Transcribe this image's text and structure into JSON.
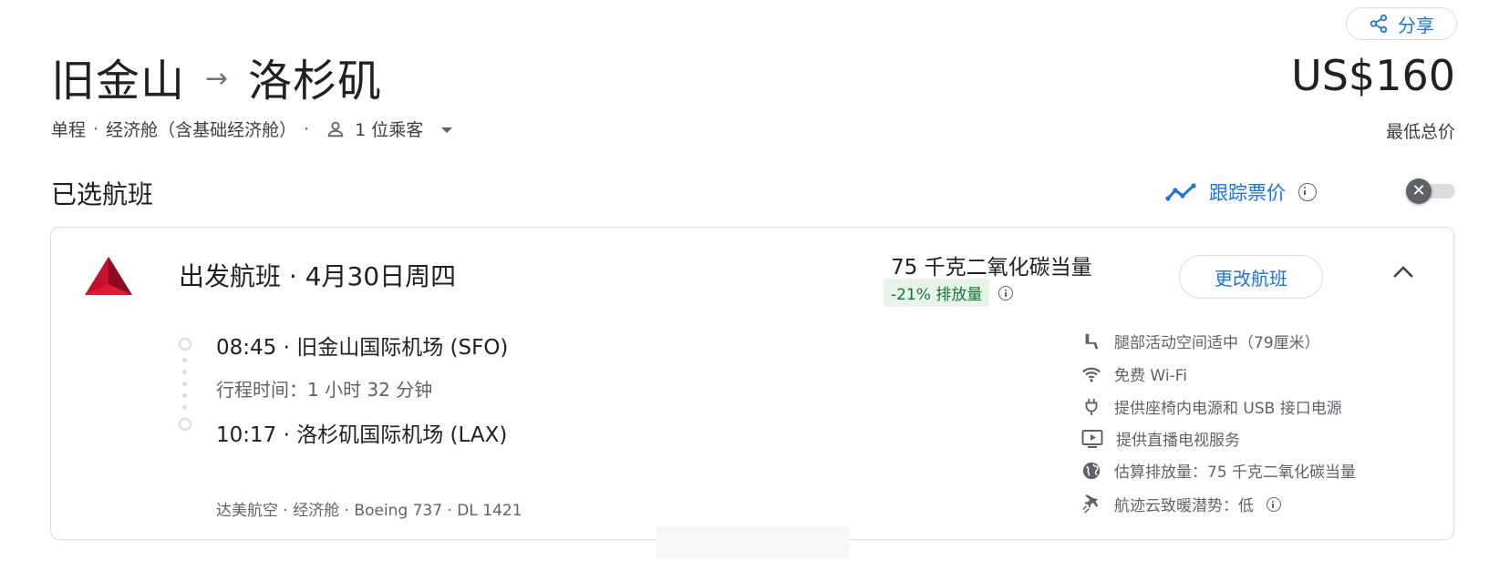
{
  "header": {
    "share_label": "分享",
    "origin": "旧金山",
    "arrow": "→",
    "destination": "洛杉矶",
    "price": "US$160",
    "price_label": "最低总价",
    "trip_type": "单程",
    "cabin": "经济舱（含基础经济舱）",
    "passengers": "1 位乘客"
  },
  "selected": {
    "title": "已选航班",
    "track_label": "跟踪票价",
    "toggle_icon": "✕"
  },
  "flight": {
    "title": "出发航班 · 4月30日周四",
    "co2": "75 千克二氧化碳当量",
    "co2_badge": "-21% 排放量",
    "change_label": "更改航班",
    "departure": "08:45 · 旧金山国际机场 (SFO)",
    "duration": "行程时间：1 小时 32 分钟",
    "arrival": "10:17 · 洛杉矶国际机场 (LAX)",
    "meta": "达美航空 · 经济舱 · Boeing 737 · DL 1421",
    "amenities": [
      {
        "icon": "seat-legroom-icon",
        "label": "腿部活动空间适中（79厘米）"
      },
      {
        "icon": "wifi-icon",
        "label": "免费 Wi-Fi"
      },
      {
        "icon": "power-plug-icon",
        "label": "提供座椅内电源和 USB 接口电源"
      },
      {
        "icon": "tv-icon",
        "label": "提供直播电视服务"
      },
      {
        "icon": "globe-icon",
        "label": "估算排放量：75 千克二氧化碳当量"
      },
      {
        "icon": "contrail-icon",
        "label": "航迹云致暖潜势：低"
      }
    ]
  },
  "colors": {
    "accent": "#1a73e8",
    "delta_red": "#c8102e",
    "green_badge_bg": "#e6f4ea",
    "green_badge_text": "#137333"
  }
}
